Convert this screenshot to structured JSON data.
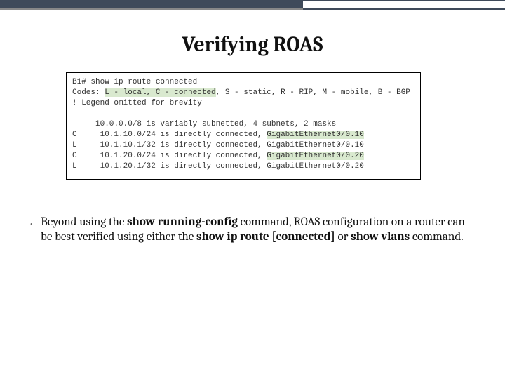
{
  "title": "Verifying ROAS",
  "terminal": {
    "prompt": "B1# show ip route connected",
    "codes_pre": "Codes: ",
    "codes_hl": "L - local, C - connected",
    "codes_post": ", S - static, R - RIP, M - mobile, B - BGP",
    "legend": "! Legend omitted for brevity",
    "summary": "     10.0.0.0/8 is variably subnetted, 4 subnets, 2 masks",
    "rows": [
      {
        "code": "C",
        "body": "     10.1.10.0/24 is directly connected, ",
        "if": "GigabitEthernet0/0.10",
        "hl": true
      },
      {
        "code": "L",
        "body": "     10.1.10.1/32 is directly connected, ",
        "if": "GigabitEthernet0/0.10",
        "hl": false
      },
      {
        "code": "C",
        "body": "     10.1.20.0/24 is directly connected, ",
        "if": "GigabitEthernet0/0.20",
        "hl": true
      },
      {
        "code": "L",
        "body": "     10.1.20.1/32 is directly connected, ",
        "if": "GigabitEthernet0/0.20",
        "hl": false
      }
    ]
  },
  "bullet": {
    "pre": "Beyond using the ",
    "b1": "show running-config",
    "mid1": " command, ROAS configuration on a router can be best verified using either the ",
    "b2": "show ip route [connected]",
    "mid2": " or ",
    "b3": "show vlans",
    "post": " command."
  }
}
